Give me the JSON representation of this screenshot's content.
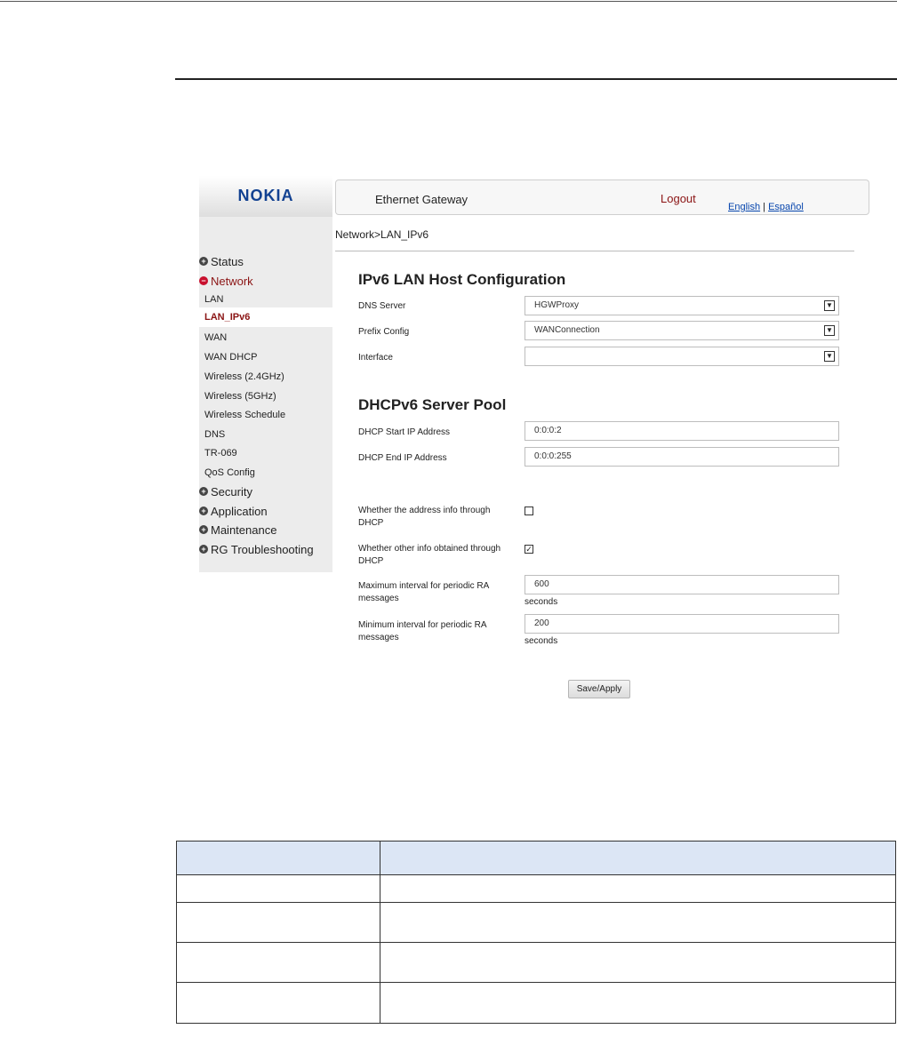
{
  "header": {
    "logo": "NOKIA",
    "title": "Ethernet Gateway",
    "logout": "Logout",
    "lang_english": "English",
    "lang_sep": " | ",
    "lang_espanol": "Español"
  },
  "breadcrumb": "Network>LAN_IPv6",
  "sidebar": {
    "status": "Status",
    "network": "Network",
    "network_items": [
      "LAN",
      "LAN_IPv6",
      "WAN",
      "WAN DHCP",
      "Wireless (2.4GHz)",
      "Wireless (5GHz)",
      "Wireless Schedule",
      "DNS",
      "TR-069",
      "QoS Config"
    ],
    "security": "Security",
    "application": "Application",
    "maintenance": "Maintenance",
    "troubleshooting": "RG Troubleshooting"
  },
  "host_config": {
    "heading": "IPv6 LAN Host Configuration",
    "dns_server_label": "DNS Server",
    "dns_server_value": "HGWProxy",
    "prefix_config_label": "Prefix Config",
    "prefix_config_value": "WANConnection",
    "interface_label": "Interface",
    "interface_value": ""
  },
  "server_pool": {
    "heading": "DHCPv6 Server Pool",
    "start_label": "DHCP Start IP Address",
    "start_value": "0:0:0:2",
    "end_label": "DHCP End IP Address",
    "end_value": "0:0:0:255"
  },
  "options": {
    "address_info_label_1": "Whether the address info through",
    "address_info_label_2": "DHCP",
    "address_info_checked": false,
    "other_info_label_1": "Whether other info obtained through",
    "other_info_label_2": "DHCP",
    "other_info_checked": true,
    "max_ra_label_1": "Maximum interval for periodic RA",
    "max_ra_label_2": "messages",
    "max_ra_value": "600",
    "max_ra_unit": "seconds",
    "min_ra_label_1": "Minimum interval for periodic RA",
    "min_ra_label_2": "messages",
    "min_ra_value": "200",
    "min_ra_unit": "seconds",
    "save_label": "Save/Apply"
  },
  "colors": {
    "brand": "#124191",
    "active_nav": "#8b1414",
    "table_header": "#dce6f5"
  }
}
